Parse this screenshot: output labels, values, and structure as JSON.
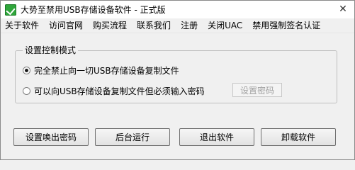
{
  "window": {
    "title": "大势至禁用USB存储设备软件 - 正式版",
    "close_glyph": "✕",
    "icon": "green-check-icon"
  },
  "menu": [
    "关于软件",
    "访问官网",
    "购买流程",
    "联系我们",
    "注册",
    "关闭UAC",
    "禁用强制签名认证"
  ],
  "control_mode": {
    "legend": "设置控制模式",
    "option1_label": "完全禁止向一切USB存储设备复制文件",
    "option1_checked": true,
    "option2_label": "可以向USB存储设备复制文件但必须输入密码",
    "option2_checked": false,
    "set_password_button": "设置密码"
  },
  "buttons": {
    "wakeup_password": "设置唤出密码",
    "background_run": "后台运行",
    "exit": "退出软件",
    "uninstall": "卸载软件"
  }
}
